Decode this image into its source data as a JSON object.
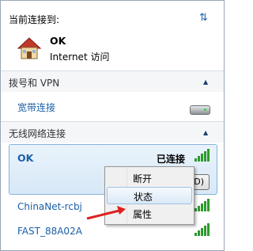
{
  "header": {
    "title": "当前连接到:",
    "refresh_icon": "refresh-icon"
  },
  "current": {
    "name": "OK",
    "status": "Internet 访问"
  },
  "sections": [
    {
      "label": "拨号和 VPN"
    },
    {
      "label": "无线网络连接"
    }
  ],
  "broadband": {
    "label": "宽带连接"
  },
  "wireless": {
    "selected": {
      "name": "OK",
      "state": "已连接",
      "button_label": "(D)"
    },
    "others": [
      {
        "name": "ChinaNet-rcbj"
      },
      {
        "name": "FAST_88A02A"
      }
    ]
  },
  "context_menu": {
    "items": [
      {
        "label": "断开"
      },
      {
        "label": "状态"
      },
      {
        "label": "属性"
      }
    ]
  },
  "colors": {
    "accent_link": "#1a5fa8",
    "signal": "#2c9a2c",
    "arrow": "#e02020"
  }
}
